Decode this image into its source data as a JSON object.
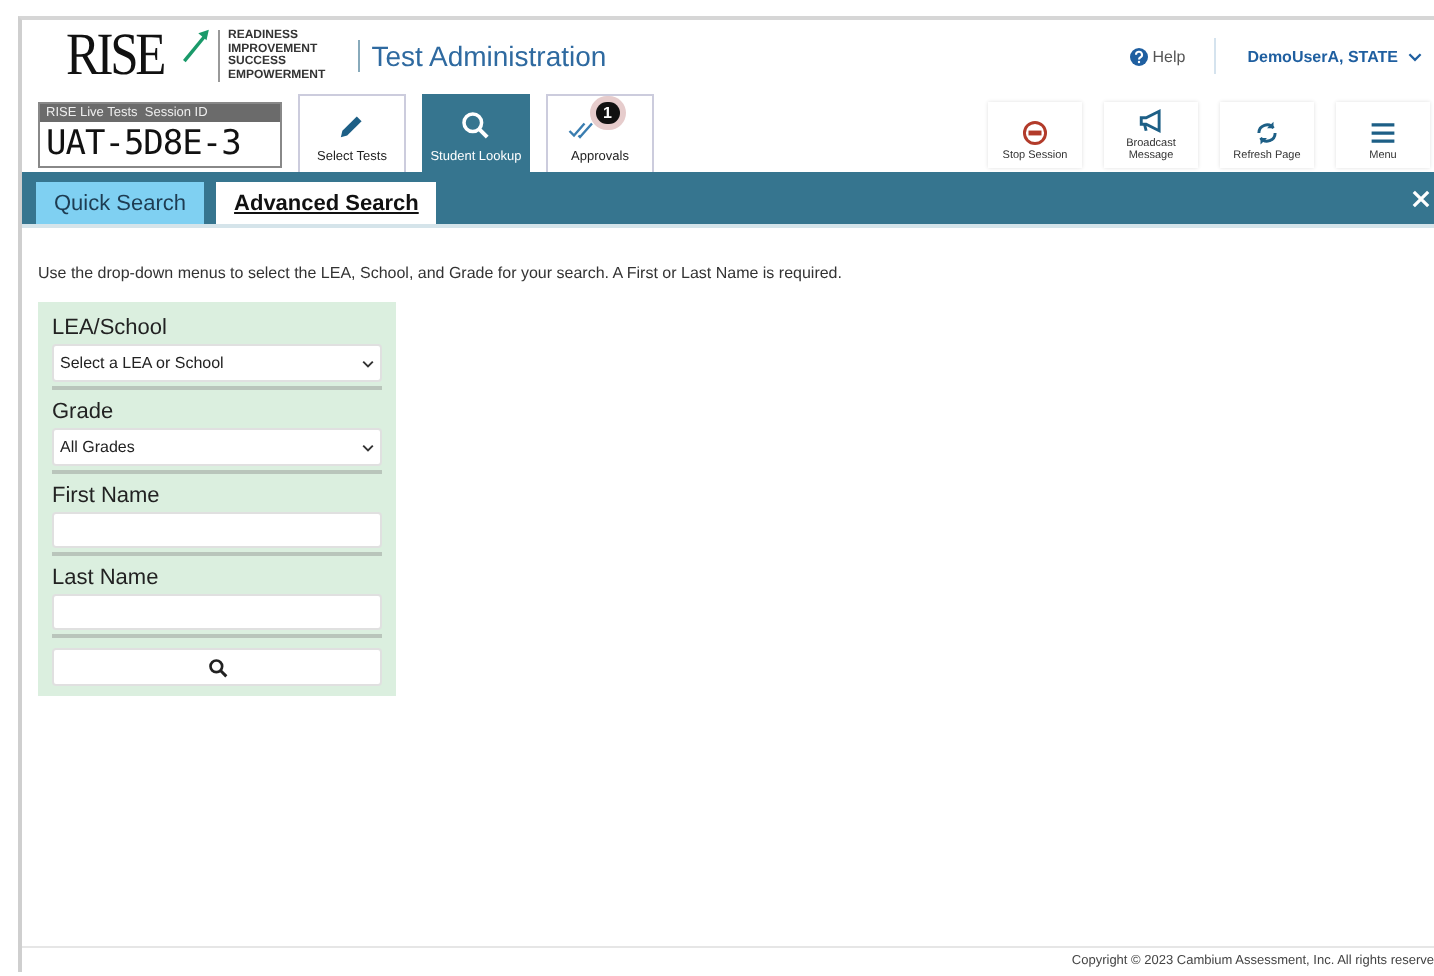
{
  "logo": {
    "wordmark": "RISE",
    "tagline": [
      "READINESS",
      "IMPROVEMENT",
      "SUCCESS",
      "EMPOWERMENT"
    ]
  },
  "app_title": "Test Administration",
  "help": "Help",
  "user": "DemoUserA, STATE",
  "session": {
    "label": "RISE Live Tests  Session ID",
    "id": "UAT-5D8E-3"
  },
  "tools": [
    {
      "kind": "pencil",
      "label": "Select Tests",
      "selected": false
    },
    {
      "kind": "search",
      "label": "Student Lookup",
      "selected": true
    },
    {
      "kind": "checks",
      "label": "Approvals",
      "selected": false,
      "badge": "1"
    }
  ],
  "actions": [
    {
      "kind": "stop",
      "label": "Stop Session"
    },
    {
      "kind": "megaphone",
      "label": "Broadcast Message"
    },
    {
      "kind": "refresh",
      "label": "Refresh Page"
    },
    {
      "kind": "menu",
      "label": "Menu"
    }
  ],
  "tabs": [
    {
      "label": "Quick Search",
      "selected": false
    },
    {
      "label": "Advanced Search",
      "selected": true
    }
  ],
  "instructions": "Use the drop-down menus to select the LEA, School, and Grade for your search. A First or Last Name is required.",
  "fields": [
    {
      "kind": "select",
      "label": "LEA/School",
      "value": "Select a LEA or School"
    },
    {
      "kind": "select",
      "label": "Grade",
      "value": "All Grades"
    },
    {
      "kind": "text",
      "label": "First Name"
    },
    {
      "kind": "text",
      "label": "Last Name"
    }
  ],
  "footer": "Copyright © 2023 Cambium Assessment, Inc. All rights reserve"
}
